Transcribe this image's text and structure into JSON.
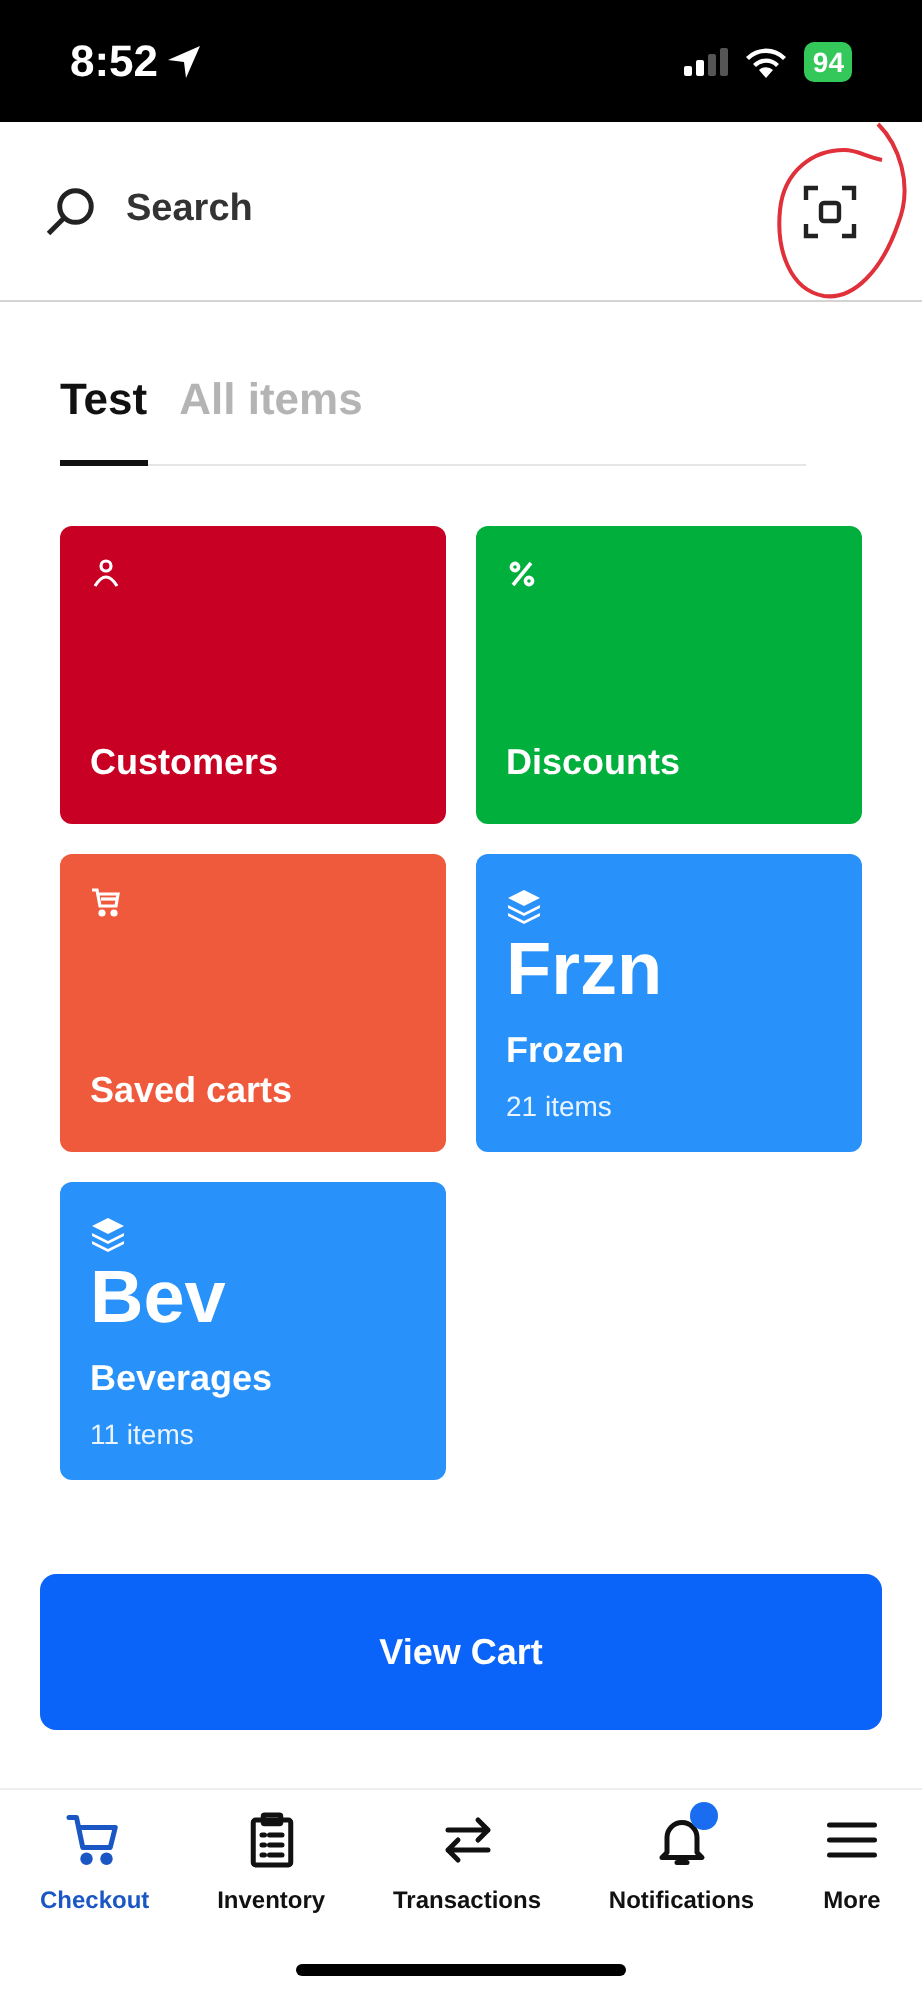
{
  "status_bar": {
    "time": "8:52",
    "battery": "94"
  },
  "search": {
    "placeholder": "Search"
  },
  "tabs": [
    {
      "label": "Test",
      "selected": true
    },
    {
      "label": "All items",
      "selected": false
    }
  ],
  "tile_rows": [
    {
      "tiles": [
        {
          "kind": "action",
          "label": "Customers",
          "color": "#c80024"
        },
        {
          "kind": "action",
          "label": "Discounts",
          "color": "#00af3c"
        }
      ]
    },
    {
      "tiles": [
        {
          "kind": "action",
          "label": "Saved carts",
          "color": "#f05a3c"
        },
        {
          "kind": "category",
          "abbreviation": "Frzn",
          "label": "Frozen",
          "count": "21 items",
          "color": "#2891fa"
        }
      ]
    },
    {
      "tiles": [
        {
          "kind": "category",
          "abbreviation": "Bev",
          "label": "Beverages",
          "count": "11 items",
          "color": "#2891fa"
        }
      ]
    }
  ],
  "view_cart_button": "View Cart",
  "nav": [
    {
      "label": "Checkout",
      "selected": true,
      "dot": false
    },
    {
      "label": "Inventory",
      "selected": false,
      "dot": false
    },
    {
      "label": "Transactions",
      "selected": false,
      "dot": false
    },
    {
      "label": "Notifications",
      "selected": false,
      "dot": true
    },
    {
      "label": "More",
      "selected": false,
      "dot": false
    }
  ]
}
